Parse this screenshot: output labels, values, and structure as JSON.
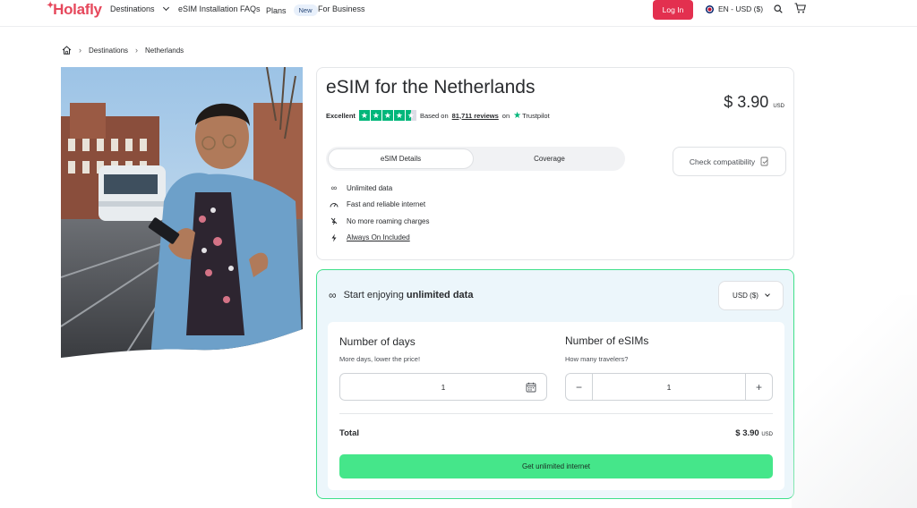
{
  "nav": {
    "logo": "Holafly",
    "destinations": "Destinations",
    "esim_installation": "eSIM Installation",
    "faqs": "FAQs",
    "plans": "Plans",
    "new_badge": "New",
    "for_business": "For Business",
    "login": "Log In",
    "language_currency": "EN - USD ($)"
  },
  "breadcrumb": {
    "items": [
      "Destinations",
      "Netherlands"
    ]
  },
  "product": {
    "title": "eSIM for the Netherlands",
    "price": "$ 3.90",
    "price_currency": "USD",
    "rating_label": "Excellent",
    "rating_stars": 4.5,
    "based_on": "Based on",
    "reviews_link": "81,711 reviews",
    "on": "on",
    "trustpilot": "Trustpilot",
    "tabs": [
      "eSIM Details",
      "Coverage"
    ],
    "check_compat": "Check compatibility",
    "features": [
      "Unlimited data",
      "Fast and reliable internet",
      "No more roaming charges",
      "Always On Included"
    ]
  },
  "plan": {
    "heading_prefix": "Start enjoying",
    "heading_bold": "unlimited data",
    "currency_select": "USD ($)",
    "days_label": "Number of days",
    "days_sub": "More days, lower the price!",
    "days_value": "1",
    "esims_label": "Number of eSIMs",
    "esims_sub": "How many travelers?",
    "esims_value": "1",
    "total_label": "Total",
    "total_value": "$ 3.90",
    "total_currency": "USD",
    "cta": "Get unlimited internet"
  },
  "colors": {
    "brand": "#e6485c",
    "login": "#e3304f",
    "cta": "#45e68a",
    "plan_border": "#3fe08a",
    "trustpilot": "#00b67a"
  }
}
